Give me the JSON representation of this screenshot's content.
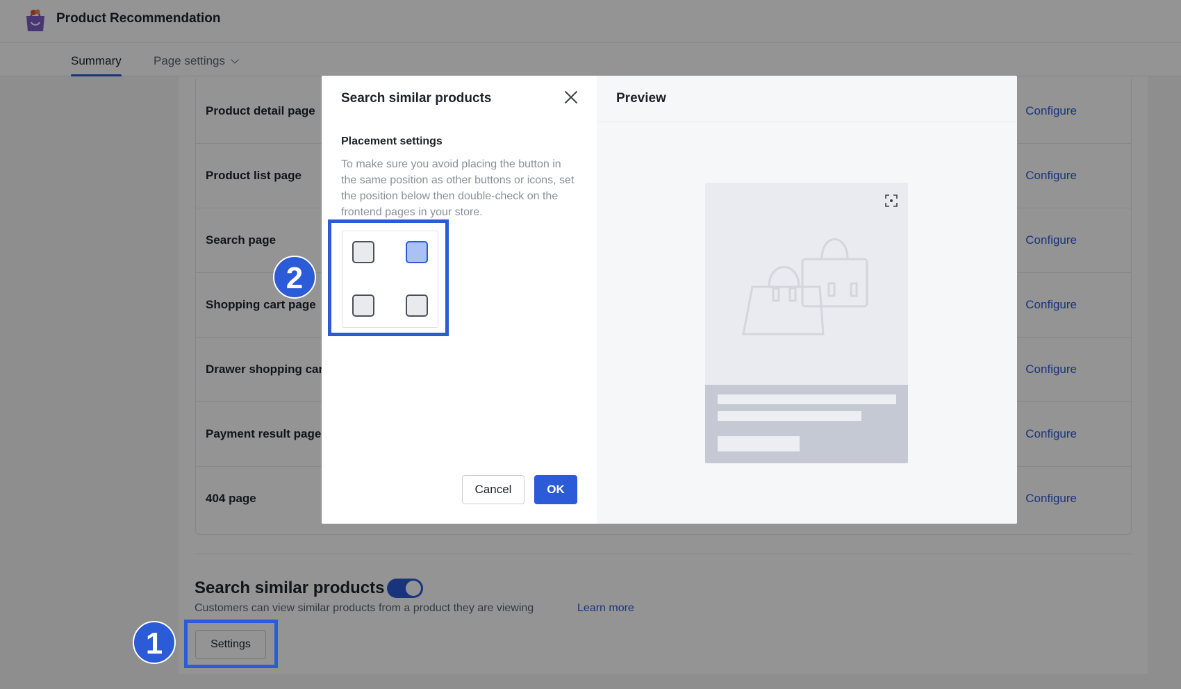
{
  "app": {
    "title": "Product Recommendation"
  },
  "tabs": [
    {
      "label": "Summary",
      "active": true
    },
    {
      "label": "Page settings",
      "active": false
    }
  ],
  "pages": {
    "action_label": "Configure",
    "rows": [
      {
        "label": "Product detail page"
      },
      {
        "label": "Product list page"
      },
      {
        "label": "Search page"
      },
      {
        "label": "Shopping cart page"
      },
      {
        "label": "Drawer shopping cart"
      },
      {
        "label": "Payment result page"
      },
      {
        "label": "404 page"
      }
    ]
  },
  "search_similar": {
    "title": "Search similar products",
    "enabled": true,
    "description": "Customers can view similar products from a product they are viewing",
    "learn_more": "Learn more",
    "settings_label": "Settings"
  },
  "modal": {
    "title": "Search similar products",
    "placement_title": "Placement settings",
    "placement_desc": "To make sure you avoid placing the button in the same position as other buttons or icons, set the position below then double-check on the frontend pages in your store.",
    "positions": [
      "top-left",
      "top-right",
      "bottom-left",
      "bottom-right"
    ],
    "selected_position": "top-right",
    "cancel_label": "Cancel",
    "ok_label": "OK",
    "preview_title": "Preview"
  },
  "annotations": {
    "step_1": "1",
    "step_2": "2"
  },
  "colors": {
    "accent": "#2b5bd7",
    "overlay": "rgba(0,0,0,0.42)",
    "selected_cell": "#a9c1f5"
  },
  "icons": [
    "bag-logo-icon",
    "chevron-down-icon",
    "close-icon",
    "fullscreen-icon",
    "shopping-bag-icon"
  ]
}
